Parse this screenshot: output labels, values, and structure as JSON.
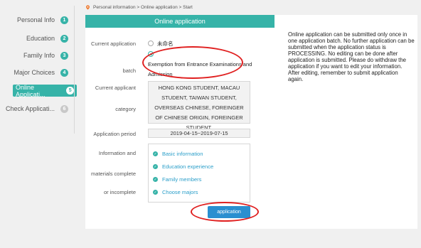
{
  "sidebar": {
    "items": [
      {
        "label": "Personal Info",
        "num": "1"
      },
      {
        "label": "Education",
        "num": "2"
      },
      {
        "label": "Family Info",
        "num": "3"
      },
      {
        "label": "Major Choices",
        "num": "4"
      },
      {
        "label": "Online Applicati...",
        "num": "5"
      },
      {
        "label": "Check Applicati...",
        "num": "6"
      }
    ]
  },
  "breadcrumb": "Personal information > Online application > Start",
  "panel": {
    "title": "Online application",
    "current_batch_label_1": "Current application",
    "current_batch_label_2": "batch",
    "batch_options": [
      {
        "label": "未命名",
        "selected": false
      },
      {
        "label": "Exemption from Entrance Examinations and Admission",
        "selected": true
      }
    ],
    "category_label_1": "Current applicant",
    "category_label_2": "category",
    "category_value": "HONG KONG STUDENT, MACAU STUDENT, TAIWAN STUDENT, OVERSEAS CHINESE, FOREINGER OF CHINESE ORIGIN, FOREINGER STUDENT,",
    "period_label": "Application period",
    "period_value": "2019-04-15~2019-07-15",
    "materials_label_1": "Information and",
    "materials_label_2": "materials complete",
    "materials_label_3": "or incomplete",
    "materials": [
      "Basic information",
      "Education experience",
      "Family members",
      "Choose majors"
    ],
    "apply_button": "application"
  },
  "note": "Online application can be submitted only once in one application batch. No further application can be submitted when the application status is PROCESSING. No editing can be done after application is submitted. Please do withdraw the application if you want to edit your information. After editing, remember to submit application again.",
  "colors": {
    "accent": "#36b3a8",
    "button": "#2a8fd0",
    "annotation": "#e02020"
  }
}
